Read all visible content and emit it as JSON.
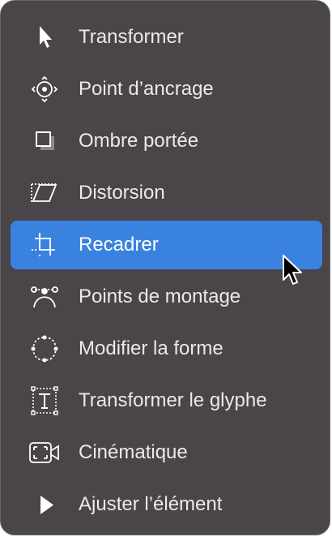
{
  "menu": {
    "items": [
      {
        "label": "Transformer",
        "icon": "arrow-pointer-icon"
      },
      {
        "label": "Point d’ancrage",
        "icon": "anchor-point-icon"
      },
      {
        "label": "Ombre portée",
        "icon": "drop-shadow-icon"
      },
      {
        "label": "Distorsion",
        "icon": "distort-icon"
      },
      {
        "label": "Recadrer",
        "icon": "crop-icon",
        "selected": true
      },
      {
        "label": "Points de montage",
        "icon": "edit-points-icon"
      },
      {
        "label": "Modifier la forme",
        "icon": "edit-shape-icon"
      },
      {
        "label": "Transformer le glyphe",
        "icon": "transform-glyph-icon"
      },
      {
        "label": "Cinématique",
        "icon": "kinematic-icon"
      },
      {
        "label": "Ajuster l’élément",
        "icon": "adjust-item-icon"
      }
    ]
  },
  "colors": {
    "menu_background": "#4a4548",
    "selection": "#3a82e0",
    "text": "#ece9eb"
  }
}
